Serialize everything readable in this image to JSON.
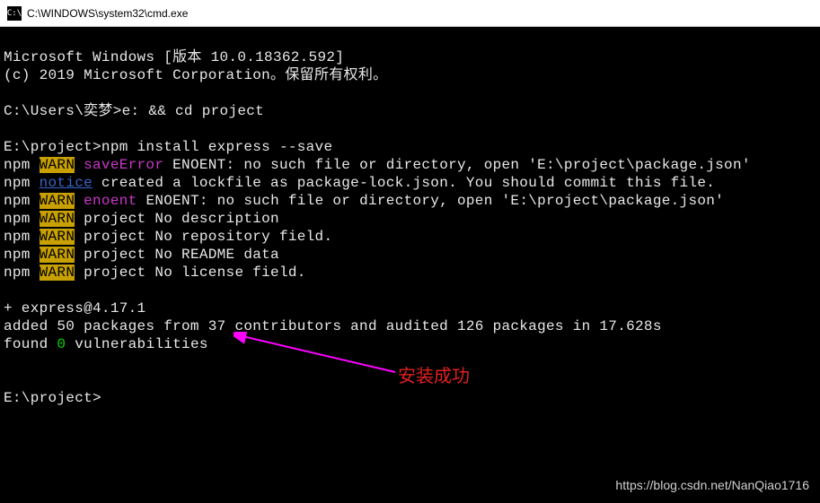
{
  "window": {
    "title": "C:\\WINDOWS\\system32\\cmd.exe",
    "icon_label": "C:\\"
  },
  "terminal": {
    "line1_a": "Microsoft Windows [版本 10.0.18362.592]",
    "line2_a": "(c) 2019 Microsoft Corporation。保留所有权利。",
    "prompt1_path": "C:\\Users\\奕梦>",
    "prompt1_cmd": "e: && cd project",
    "prompt2_path": "E:\\project>",
    "prompt2_cmd": "npm install express --save",
    "npm1_prefix": "npm ",
    "npm1_warn": "WARN",
    "npm1_space": " ",
    "npm1_code": "saveError",
    "npm1_msg": " ENOENT: no such file or directory, open 'E:\\project\\package.json'",
    "npm2_prefix": "npm ",
    "npm2_code": "notice",
    "npm2_msg": " created a lockfile as package-lock.json. You should commit this file.",
    "npm3_prefix": "npm ",
    "npm3_warn": "WARN",
    "npm3_space": " ",
    "npm3_code": "enoent",
    "npm3_msg": " ENOENT: no such file or directory, open 'E:\\project\\package.json'",
    "npm4_prefix": "npm ",
    "npm4_warn": "WARN",
    "npm4_msg": " project No description",
    "npm5_prefix": "npm ",
    "npm5_warn": "WARN",
    "npm5_msg": " project No repository field.",
    "npm6_prefix": "npm ",
    "npm6_warn": "WARN",
    "npm6_msg": " project No README data",
    "npm7_prefix": "npm ",
    "npm7_warn": "WARN",
    "npm7_msg": " project No license field.",
    "result_pkg": "+ express@4.17.1",
    "result_added": "added 50 packages from 37 contributors and audited 126 packages in 17.628s",
    "result_found_a": "found ",
    "result_found_n": "0",
    "result_found_b": " vulnerabilities",
    "prompt3_path": "E:\\project>"
  },
  "annotation": {
    "text": "安装成功"
  },
  "watermark": "https://blog.csdn.net/NanQiao1716"
}
